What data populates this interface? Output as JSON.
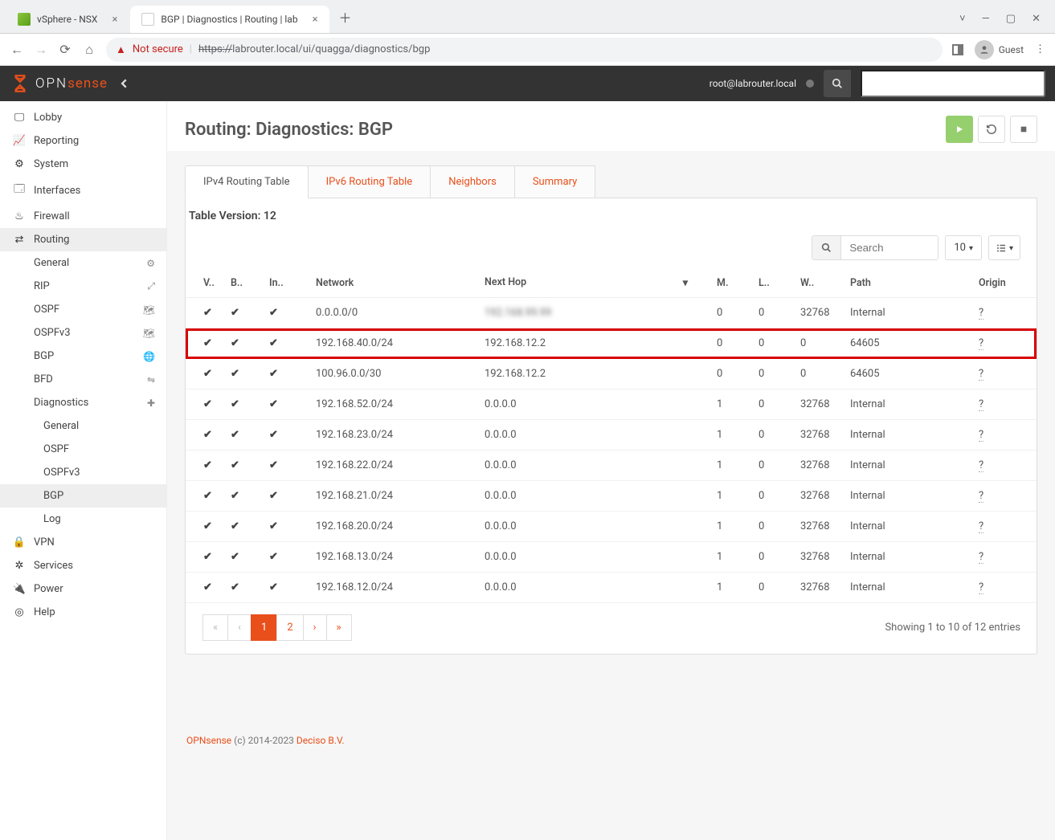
{
  "browser": {
    "tabs": [
      {
        "title": "vSphere - NSX",
        "active": false
      },
      {
        "title": "BGP | Diagnostics | Routing | lab",
        "active": true
      }
    ],
    "nav_back": "←",
    "nav_fwd": "→",
    "reload": "⟳",
    "home": "⌂",
    "not_secure": "Not secure",
    "url_scheme": "https://",
    "url_rest": "labrouter.local/ui/quagga/diagnostics/bgp",
    "guest_label": "Guest",
    "win_min": "—",
    "win_max": "▢",
    "win_close": "✕",
    "win_down": "˅"
  },
  "header": {
    "logo1": "OPN",
    "logo2": "sense",
    "user": "root@labrouter.local"
  },
  "sidebar": {
    "items": [
      {
        "label": "Lobby"
      },
      {
        "label": "Reporting"
      },
      {
        "label": "System"
      },
      {
        "label": "Interfaces"
      },
      {
        "label": "Firewall"
      },
      {
        "label": "Routing"
      }
    ],
    "routing": [
      {
        "label": "General",
        "icon": "gear"
      },
      {
        "label": "RIP",
        "icon": "expand"
      },
      {
        "label": "OSPF",
        "icon": "map"
      },
      {
        "label": "OSPFv3",
        "icon": "map"
      },
      {
        "label": "BGP",
        "icon": "globe"
      },
      {
        "label": "BFD",
        "icon": "swap"
      },
      {
        "label": "Diagnostics",
        "icon": "medkit"
      }
    ],
    "diag": [
      {
        "label": "General"
      },
      {
        "label": "OSPF"
      },
      {
        "label": "OSPFv3"
      },
      {
        "label": "BGP"
      },
      {
        "label": "Log"
      }
    ],
    "tail": [
      {
        "label": "VPN"
      },
      {
        "label": "Services"
      },
      {
        "label": "Power"
      },
      {
        "label": "Help"
      }
    ]
  },
  "page": {
    "title": "Routing: Diagnostics: BGP",
    "tabs": [
      {
        "label": "IPv4 Routing Table",
        "active": true
      },
      {
        "label": "IPv6 Routing Table",
        "active": false
      },
      {
        "label": "Neighbors",
        "active": false
      },
      {
        "label": "Summary",
        "active": false
      }
    ],
    "table_version_label": "Table Version:",
    "table_version": "12",
    "search_placeholder": "Search",
    "page_size": "10",
    "columns": {
      "valid": "V..",
      "best": "B..",
      "internal": "In..",
      "network": "Network",
      "nexthop": "Next Hop",
      "metric": "M.",
      "locpref": "L..",
      "weight": "W..",
      "path": "Path",
      "origin": "Origin"
    },
    "rows": [
      {
        "v": true,
        "b": true,
        "i": true,
        "network": "0.0.0.0/0",
        "nexthop": "",
        "nexthop_blur": true,
        "metric": "0",
        "locpref": "0",
        "weight": "32768",
        "path": "Internal",
        "origin": "?",
        "hi": false
      },
      {
        "v": true,
        "b": true,
        "i": true,
        "network": "192.168.40.0/24",
        "nexthop": "192.168.12.2",
        "metric": "0",
        "locpref": "0",
        "weight": "0",
        "path": "64605",
        "origin": "?",
        "hi": true
      },
      {
        "v": true,
        "b": true,
        "i": true,
        "network": "100.96.0.0/30",
        "nexthop": "192.168.12.2",
        "metric": "0",
        "locpref": "0",
        "weight": "0",
        "path": "64605",
        "origin": "?",
        "hi": false
      },
      {
        "v": true,
        "b": true,
        "i": true,
        "network": "192.168.52.0/24",
        "nexthop": "0.0.0.0",
        "metric": "1",
        "locpref": "0",
        "weight": "32768",
        "path": "Internal",
        "origin": "?",
        "hi": false
      },
      {
        "v": true,
        "b": true,
        "i": true,
        "network": "192.168.23.0/24",
        "nexthop": "0.0.0.0",
        "metric": "1",
        "locpref": "0",
        "weight": "32768",
        "path": "Internal",
        "origin": "?",
        "hi": false
      },
      {
        "v": true,
        "b": true,
        "i": true,
        "network": "192.168.22.0/24",
        "nexthop": "0.0.0.0",
        "metric": "1",
        "locpref": "0",
        "weight": "32768",
        "path": "Internal",
        "origin": "?",
        "hi": false
      },
      {
        "v": true,
        "b": true,
        "i": true,
        "network": "192.168.21.0/24",
        "nexthop": "0.0.0.0",
        "metric": "1",
        "locpref": "0",
        "weight": "32768",
        "path": "Internal",
        "origin": "?",
        "hi": false
      },
      {
        "v": true,
        "b": true,
        "i": true,
        "network": "192.168.20.0/24",
        "nexthop": "0.0.0.0",
        "metric": "1",
        "locpref": "0",
        "weight": "32768",
        "path": "Internal",
        "origin": "?",
        "hi": false
      },
      {
        "v": true,
        "b": true,
        "i": true,
        "network": "192.168.13.0/24",
        "nexthop": "0.0.0.0",
        "metric": "1",
        "locpref": "0",
        "weight": "32768",
        "path": "Internal",
        "origin": "?",
        "hi": false
      },
      {
        "v": true,
        "b": true,
        "i": true,
        "network": "192.168.12.0/24",
        "nexthop": "0.0.0.0",
        "metric": "1",
        "locpref": "0",
        "weight": "32768",
        "path": "Internal",
        "origin": "?",
        "hi": false
      }
    ],
    "pager": {
      "first": "«",
      "prev": "‹",
      "pages": [
        "1",
        "2"
      ],
      "next": "›",
      "last": "»",
      "active": "1"
    },
    "entries": "Showing 1 to 10 of 12 entries"
  },
  "footer": {
    "brand": "OPNsense",
    "copy": " (c) 2014-2023 ",
    "co": "Deciso B.V."
  }
}
